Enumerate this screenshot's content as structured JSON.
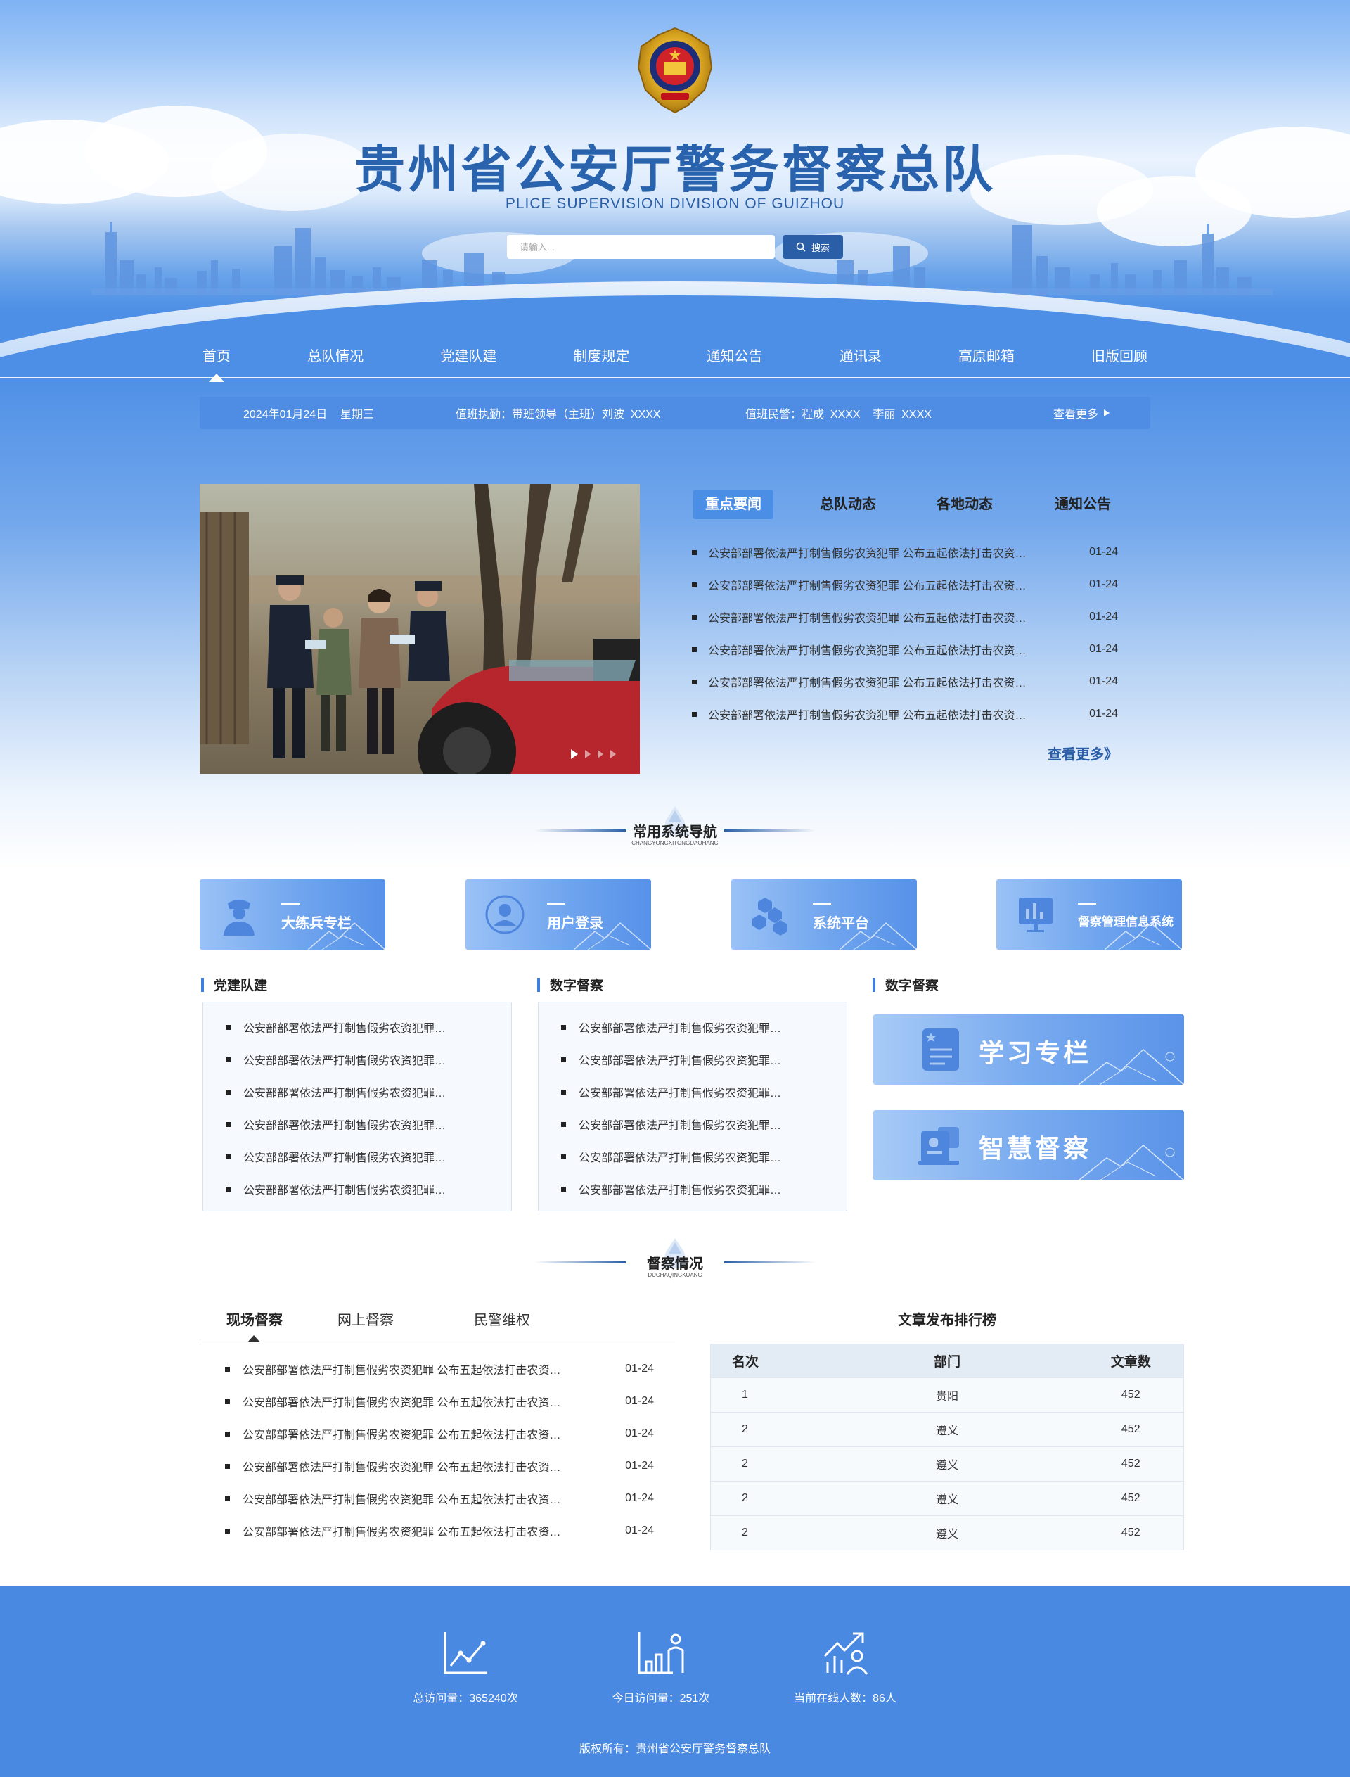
{
  "header": {
    "title": "贵州省公安厅警务督察总队",
    "subtitle": "PLICE SUPERVISION DIVISION OF GUIZHOU",
    "search": {
      "placeholder": "请输入...",
      "button_label": "搜索"
    }
  },
  "nav": {
    "items": [
      "首页",
      "总队情况",
      "党建队建",
      "制度规定",
      "通知公告",
      "通讯录",
      "高原邮箱",
      "旧版回顾"
    ],
    "active_index": 0
  },
  "duty_bar": {
    "date": "2024年01月24日",
    "weekday": "星期三",
    "leader": "值班执勤：带班领导（主班）刘波  XXXX",
    "police": "值班民警：程成  XXXX    李丽  XXXX",
    "more": "查看更多"
  },
  "news": {
    "tabs": [
      "重点要闻",
      "总队动态",
      "各地动态",
      "通知公告"
    ],
    "active_tab": 0,
    "items": [
      {
        "title": "公安部部署依法严打制售假劣农资犯罪 公布五起依法打击农资犯罪典型案例",
        "date": "01-24"
      },
      {
        "title": "公安部部署依法严打制售假劣农资犯罪 公布五起依法打击农资犯罪典型案例",
        "date": "01-24"
      },
      {
        "title": "公安部部署依法严打制售假劣农资犯罪 公布五起依法打击农资犯罪典型案例",
        "date": "01-24"
      },
      {
        "title": "公安部部署依法严打制售假劣农资犯罪 公布五起依法打击农资犯罪典型案例",
        "date": "01-24"
      },
      {
        "title": "公安部部署依法严打制售假劣农资犯罪 公布五起依法打击农资犯罪典型案例",
        "date": "01-24"
      },
      {
        "title": "公安部部署依法严打制售假劣农资犯罪 公布五起依法打击农资犯罪典型案例",
        "date": "01-24"
      }
    ],
    "more": "查看更多》",
    "slider": {
      "slides": 4,
      "current": 1
    }
  },
  "system_nav": {
    "title": "常用系统导航",
    "title_pinyin": "CHANGYONGXITONGDAOHANG",
    "items": [
      {
        "label": "大练兵专栏",
        "icon": "police-officer-icon"
      },
      {
        "label": "用户登录",
        "icon": "user-icon"
      },
      {
        "label": "系统平台",
        "icon": "cubes-icon"
      },
      {
        "label": "督察管理信息系统",
        "icon": "monitor-chart-icon"
      }
    ]
  },
  "columns": {
    "party": {
      "title": "党建队建",
      "items": [
        "公安部部署依法严打制售假劣农资犯罪 公布五起依法打击农资犯罪典型案例",
        "公安部部署依法严打制售假劣农资犯罪 公布五起依法打击农资犯罪典型案例",
        "公安部部署依法严打制售假劣农资犯罪 公布五起依法打击农资犯罪典型案例",
        "公安部部署依法严打制售假劣农资犯罪 公布五起依法打击农资犯罪典型案例",
        "公安部部署依法严打制售假劣农资犯罪 公布五起依法打击农资犯罪典型案例",
        "公安部部署依法严打制售假劣农资犯罪 公布五起依法打击农资犯罪典型案例"
      ]
    },
    "digital": {
      "title": "数字督察",
      "items": [
        "公安部部署依法严打制售假劣农资犯罪 公布五起依法打击农资犯罪典型案例",
        "公安部部署依法严打制售假劣农资犯罪 公布五起依法打击农资犯罪典型案例",
        "公安部部署依法严打制售假劣农资犯罪 公布五起依法打击农资犯罪典型案例",
        "公安部部署依法严打制售假劣农资犯罪 公布五起依法打击农资犯罪典型案例",
        "公安部部署依法严打制售假劣农资犯罪 公布五起依法打击农资犯罪典型案例",
        "公安部部署依法严打制售假劣农资犯罪 公布五起依法打击农资犯罪典型案例"
      ]
    },
    "digital2": {
      "title": "数字督察",
      "cards": [
        {
          "label": "学习专栏",
          "icon": "study-book-icon"
        },
        {
          "label": "智慧督察",
          "icon": "id-badge-icon"
        }
      ]
    }
  },
  "supervision": {
    "title": "督察情况",
    "title_pinyin": "DUCHAQINGKUANG",
    "tabs": [
      "现场督察",
      "网上督察",
      "民警维权"
    ],
    "active_tab": 0,
    "items": [
      {
        "title": "公安部部署依法严打制售假劣农资犯罪 公布五起依法打击农资犯罪典型案例",
        "date": "01-24"
      },
      {
        "title": "公安部部署依法严打制售假劣农资犯罪 公布五起依法打击农资犯罪典型案例",
        "date": "01-24"
      },
      {
        "title": "公安部部署依法严打制售假劣农资犯罪 公布五起依法打击农资犯罪典型案例",
        "date": "01-24"
      },
      {
        "title": "公安部部署依法严打制售假劣农资犯罪 公布五起依法打击农资犯罪典型案例",
        "date": "01-24"
      },
      {
        "title": "公安部部署依法严打制售假劣农资犯罪 公布五起依法打击农资犯罪典型案例",
        "date": "01-24"
      },
      {
        "title": "公安部部署依法严打制售假劣农资犯罪 公布五起依法打击农资犯罪典型案例",
        "date": "01-24"
      }
    ]
  },
  "ranking": {
    "title": "文章发布排行榜",
    "columns": [
      "名次",
      "部门",
      "文章数"
    ],
    "rows": [
      [
        "1",
        "贵阳",
        "452"
      ],
      [
        "2",
        "遵义",
        "452"
      ],
      [
        "2",
        "遵义",
        "452"
      ],
      [
        "2",
        "遵义",
        "452"
      ],
      [
        "2",
        "遵义",
        "452"
      ]
    ]
  },
  "footer": {
    "stats": [
      {
        "label": "总访问量：365240次",
        "icon": "line-chart-icon"
      },
      {
        "label": "今日访问量：251次",
        "icon": "bar-person-icon"
      },
      {
        "label": "当前在线人数：86人",
        "icon": "growth-people-icon"
      }
    ],
    "copyright": "版权所有：贵州省公安厅警务督察总队"
  },
  "colors": {
    "primary": "#4a89e2",
    "title_blue": "#2a63ad",
    "button_dark": "#2a5ea6",
    "nav_bg": "#4d8ee6"
  }
}
